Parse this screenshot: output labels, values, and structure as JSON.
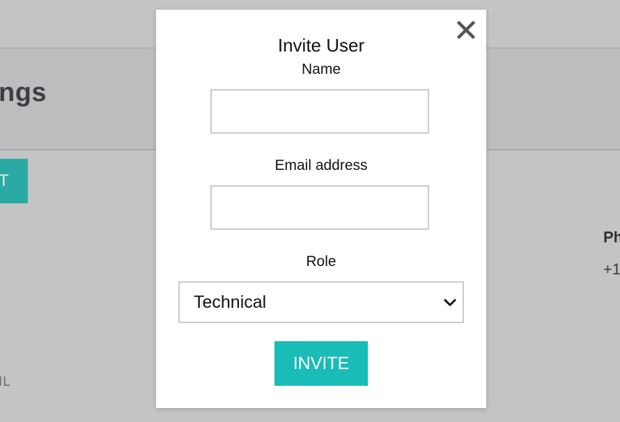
{
  "background": {
    "page_title_fragment": "ngs",
    "button_fragment": "T",
    "field_label_fragment": "Ph",
    "field_value_fragment": "+1",
    "text_fragment": "IL"
  },
  "modal": {
    "title": "Invite User",
    "close_icon": "close-icon",
    "fields": {
      "name": {
        "label": "Name",
        "value": "",
        "placeholder": ""
      },
      "email": {
        "label": "Email address",
        "value": "",
        "placeholder": ""
      },
      "role": {
        "label": "Role",
        "selected": "Technical"
      }
    },
    "invite_label": "INVITE"
  },
  "colors": {
    "accent": "#19bcb7",
    "overlay": "#c4c4c4",
    "background_teal": "#2ba9a4"
  }
}
